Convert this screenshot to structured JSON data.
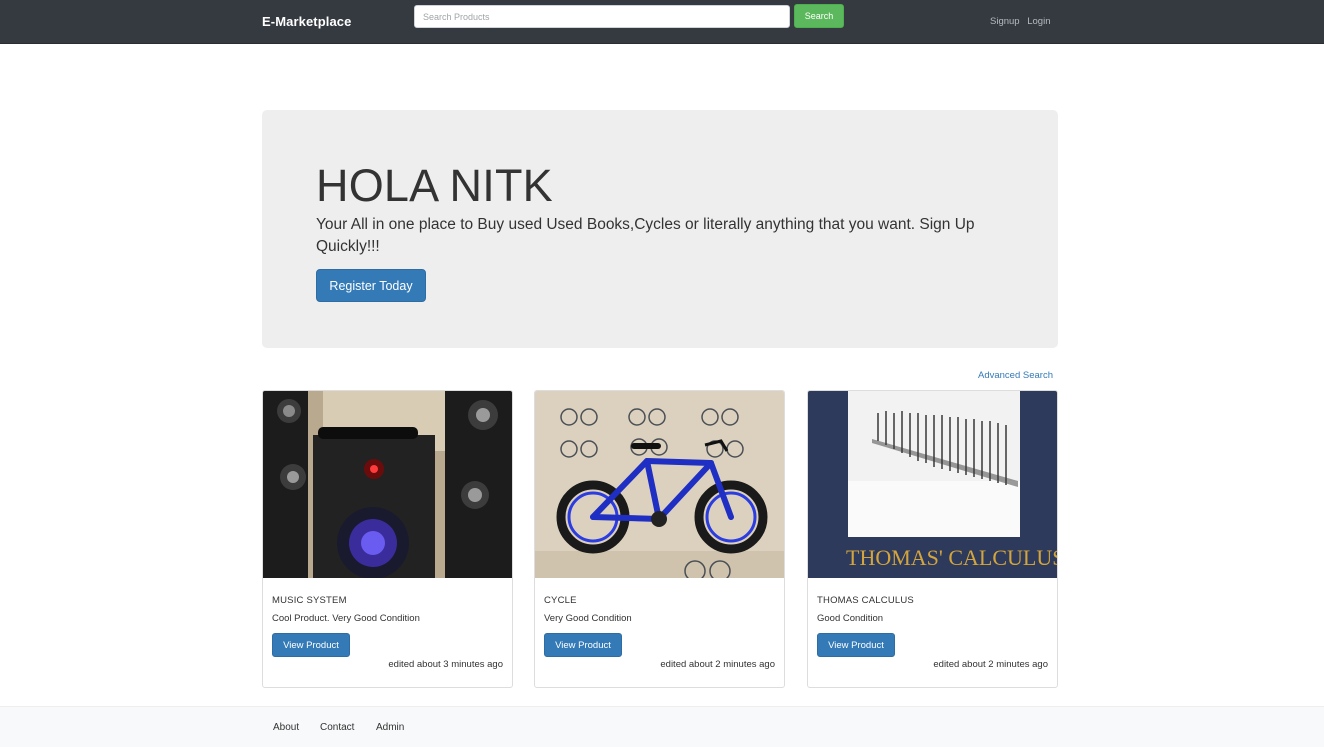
{
  "navbar": {
    "brand": "E-Marketplace",
    "search_placeholder": "Search Products",
    "search_button": "Search",
    "signup": "Signup",
    "login": "Login"
  },
  "jumbotron": {
    "title": "HOLA NITK",
    "text": "Your All in one place to Buy used Used Books,Cycles or literally anything that you want. Sign Up Quickly!!!",
    "button": "Register Today"
  },
  "advanced_search": "Advanced Search",
  "products": [
    {
      "title": "MUSIC SYSTEM",
      "description": "Cool Product. Very Good Condition",
      "button": "View Product",
      "edited": "edited about 3 minutes ago",
      "image": "music-system-photo"
    },
    {
      "title": "CYCLE",
      "description": "Very Good Condition",
      "button": "View Product",
      "edited": "edited about 2 minutes ago",
      "image": "bicycle-photo"
    },
    {
      "title": "THOMAS CALCULUS",
      "description": "Good Condition",
      "button": "View Product",
      "edited": "edited about 2 minutes ago",
      "image": "book-cover-photo",
      "image_text": "THOMAS' CALCULUS"
    }
  ],
  "footer": {
    "about": "About",
    "contact": "Contact",
    "admin": "Admin"
  },
  "colors": {
    "navbar": "#343a40",
    "primary": "#337ab7",
    "success": "#5cb85c",
    "jumbotron": "#eeeeee"
  }
}
